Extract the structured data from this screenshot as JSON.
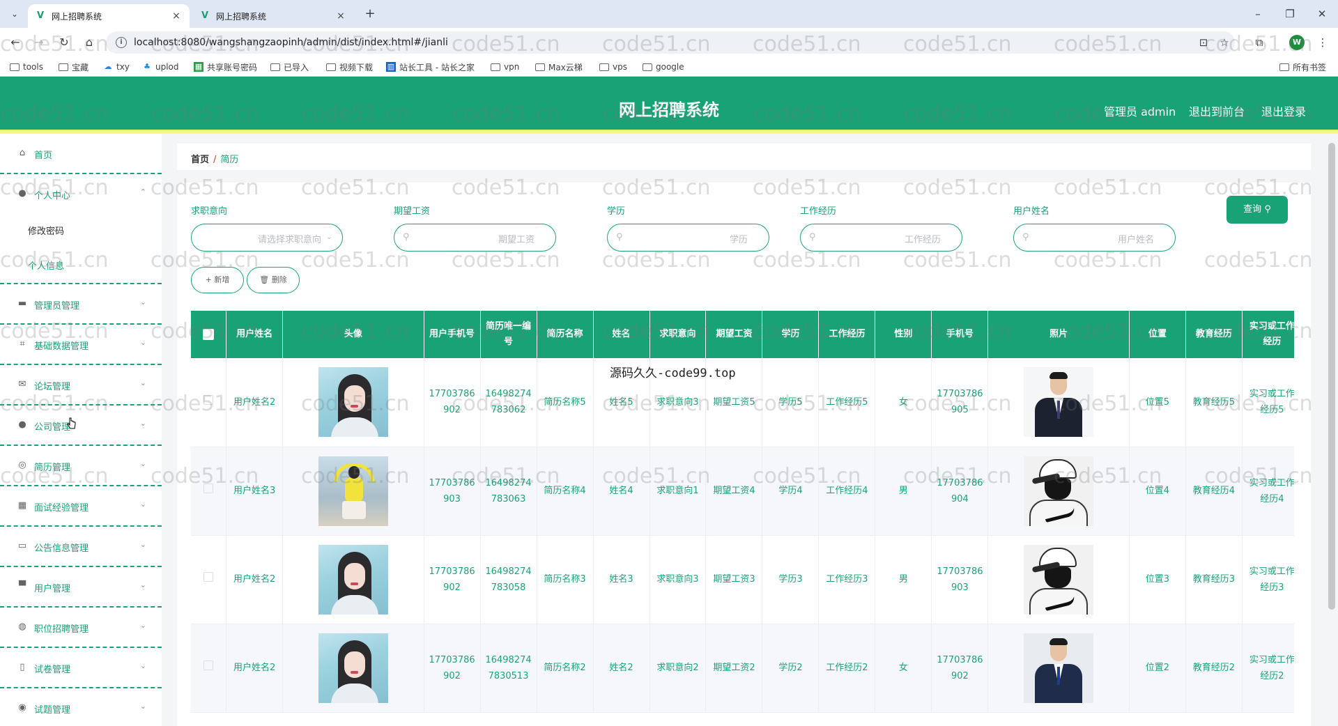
{
  "browser": {
    "tabs": [
      {
        "title": "网上招聘系统",
        "active": true
      },
      {
        "title": "网上招聘系统",
        "active": false
      }
    ],
    "url": "localhost:8080/wangshangzaopinh/admin/dist/index.html#/jianli",
    "profile_initial": "W",
    "bookmarks": [
      "tools",
      "宝藏",
      "txy",
      "uplod",
      "共享账号密码",
      "已导入",
      "视频下载",
      "站长工具 - 站长之家",
      "vpn",
      "Max云梯",
      "vps",
      "google"
    ],
    "all_bookmarks": "所有书签"
  },
  "header": {
    "title": "网上招聘系统",
    "admin_label": "管理员 admin",
    "back_front": "退出到前台",
    "logout": "退出登录"
  },
  "sidebar": {
    "items": [
      {
        "label": "首页",
        "icon": "home-icon"
      },
      {
        "label": "个人中心",
        "icon": "user-icon",
        "expanded": true
      },
      {
        "label": "管理员管理",
        "icon": "briefcase-icon"
      },
      {
        "label": "基础数据管理",
        "icon": "crop-icon"
      },
      {
        "label": "论坛管理",
        "icon": "mail-icon"
      },
      {
        "label": "公司管理",
        "icon": "user-icon"
      },
      {
        "label": "简历管理",
        "icon": "circle-icon"
      },
      {
        "label": "面试经验管理",
        "icon": "grid-icon"
      },
      {
        "label": "公告信息管理",
        "icon": "ticket-icon"
      },
      {
        "label": "用户管理",
        "icon": "monitor-icon"
      },
      {
        "label": "职位招聘管理",
        "icon": "globe-icon"
      },
      {
        "label": "试卷管理",
        "icon": "doc-icon"
      },
      {
        "label": "试题管理",
        "icon": "target-icon"
      }
    ],
    "sub_items": [
      "修改密码",
      "个人信息"
    ]
  },
  "breadcrumb": {
    "home": "首页",
    "separator": "/",
    "current": "简历"
  },
  "filters": [
    {
      "label": "求职意向",
      "placeholder": "请选择求职意向",
      "type": "select"
    },
    {
      "label": "期望工资",
      "placeholder": "期望工资",
      "type": "search"
    },
    {
      "label": "学历",
      "placeholder": "学历",
      "type": "search"
    },
    {
      "label": "工作经历",
      "placeholder": "工作经历",
      "type": "search"
    },
    {
      "label": "用户姓名",
      "placeholder": "用户姓名",
      "type": "search"
    }
  ],
  "buttons": {
    "query": "查询",
    "add": "新增",
    "delete": "删除"
  },
  "table": {
    "columns": [
      "用户姓名",
      "头像",
      "用户手机号",
      "简历唯一编号",
      "简历名称",
      "姓名",
      "求职意向",
      "期望工资",
      "学历",
      "工作经历",
      "性别",
      "手机号",
      "照片",
      "位置",
      "教育经历",
      "实习或工作经历"
    ],
    "rows": [
      {
        "user_name": "用户姓名2",
        "avatar": "girl-blue",
        "user_phone": "17703786902",
        "resume_no": "16498274783062",
        "resume_name": "简历名称5",
        "name": "姓名5",
        "intention": "求职意向3",
        "salary": "期望工资5",
        "education": "学历5",
        "work": "工作经历5",
        "gender": "女",
        "phone": "17703786905",
        "photo": "man-suit",
        "position": "位置5",
        "edu_exp": "教育经历5",
        "intern": "实习或工作经历5"
      },
      {
        "user_name": "用户姓名3",
        "avatar": "girl-yellow",
        "user_phone": "17703786903",
        "resume_no": "16498274783063",
        "resume_name": "简历名称4",
        "name": "姓名4",
        "intention": "求职意向1",
        "salary": "期望工资4",
        "education": "学历4",
        "work": "工作经历4",
        "gender": "男",
        "phone": "17703786904",
        "photo": "cap-sketch",
        "position": "位置4",
        "edu_exp": "教育经历4",
        "intern": "实习或工作经历4"
      },
      {
        "user_name": "用户姓名2",
        "avatar": "girl-blue",
        "user_phone": "17703786902",
        "resume_no": "16498274783058",
        "resume_name": "简历名称3",
        "name": "姓名3",
        "intention": "求职意向3",
        "salary": "期望工资3",
        "education": "学历3",
        "work": "工作经历3",
        "gender": "男",
        "phone": "17703786903",
        "photo": "cap-sketch",
        "position": "位置3",
        "edu_exp": "教育经历3",
        "intern": "实习或工作经历3"
      },
      {
        "user_name": "用户姓名2",
        "avatar": "girl-blue",
        "user_phone": "17703786902",
        "resume_no": "164982747830513",
        "resume_name": "简历名称2",
        "name": "姓名2",
        "intention": "求职意向2",
        "salary": "期望工资2",
        "education": "学历2",
        "work": "工作经历2",
        "gender": "女",
        "phone": "17703786902",
        "photo": "man-suit2",
        "position": "位置2",
        "edu_exp": "教育经历2",
        "intern": "实习或工作经历2"
      }
    ]
  },
  "overlay_text": "源码久久-code99.top",
  "watermark": "code51.cn",
  "colors": {
    "primary": "#1aa277",
    "header_bottom": "#eef27a"
  }
}
